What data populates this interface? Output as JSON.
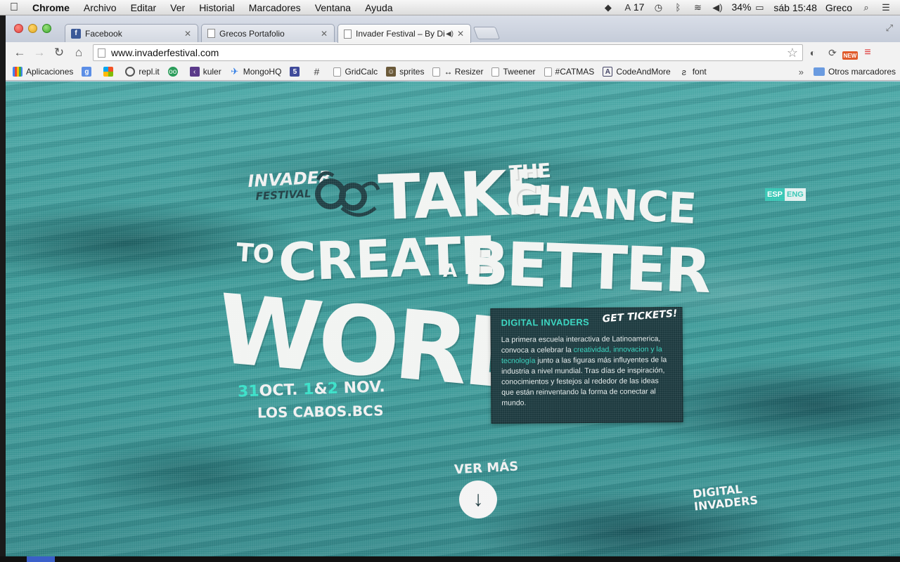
{
  "menubar": {
    "apple": "",
    "app_name": "Chrome",
    "items": [
      "Archivo",
      "Editar",
      "Ver",
      "Historial",
      "Marcadores",
      "Ventana",
      "Ayuda"
    ],
    "status": {
      "adobe_count": "17",
      "battery": "34%",
      "clock": "sáb 15:48",
      "user": "Greco"
    }
  },
  "tabs": [
    {
      "title": "Facebook",
      "icon": "facebook-icon"
    },
    {
      "title": "Grecos Portafolio",
      "icon": "page-icon"
    },
    {
      "title": "Invader Festival – By Di",
      "icon": "page-icon"
    }
  ],
  "omnibox": {
    "url": "www.invaderfestival.com"
  },
  "bookmarks": [
    {
      "label": "Aplicaciones",
      "icon": "apps-grid-icon"
    },
    {
      "label": "",
      "icon": "google-icon"
    },
    {
      "label": "",
      "icon": "microsoft-icon"
    },
    {
      "label": "repl.it",
      "icon": "replit-icon"
    },
    {
      "label": "",
      "icon": "tripadvisor-icon"
    },
    {
      "label": "kuler",
      "icon": "kuler-icon"
    },
    {
      "label": "MongoHQ",
      "icon": "mongohq-icon"
    },
    {
      "label": "",
      "icon": "html5-icon"
    },
    {
      "label": "",
      "icon": "hash-icon"
    },
    {
      "label": "GridCalc",
      "icon": "page-icon"
    },
    {
      "label": "sprites",
      "icon": "sprites-icon"
    },
    {
      "label": "↔ Resizer",
      "icon": "page-icon"
    },
    {
      "label": "Tweener",
      "icon": "page-icon"
    },
    {
      "label": "#CATMAS",
      "icon": "page-icon"
    },
    {
      "label": "CodeAndMore",
      "icon": "codeandmore-icon"
    },
    {
      "label": "font",
      "icon": "font-icon"
    }
  ],
  "bookmarks_overflow": "»",
  "other_bookmarks": "Otros marcadores",
  "page": {
    "logo": {
      "invader": "INVADER",
      "festival": "FESTIVAL"
    },
    "headline": {
      "take": "TAKE",
      "the": "THE",
      "chance": "CHANCE",
      "to": "TO",
      "create": "CREATE",
      "a": "A",
      "better": "BETTER",
      "world": "WORLD!"
    },
    "date": {
      "part1": "31",
      "part2": "OCT.",
      "part3": "1",
      "part4": "&",
      "part5": "2",
      "part6": "NOV."
    },
    "place": "LOS CABOS.BCS",
    "lang": {
      "esp": "ESP",
      "eng": "ENG"
    },
    "card": {
      "title": "DIGITAL INVADERS",
      "tickets": "GET TICKETS!",
      "body_1": "La primera escuela interactiva de Latinoamerica, convoca a celebrar la ",
      "body_hl": "creatividad, innovacion y la tecnología",
      "body_2": " junto a las figuras más influyentes de la industria a nivel mundial. Tras días de inspiración, conocimientos y festejos al rededor de las ideas que están reinventando la forma de conectar al mundo."
    },
    "ver_mas": "VER MÁS",
    "digital_logo": {
      "line1": "DIGITAL",
      "line2": "INVADERS"
    }
  }
}
